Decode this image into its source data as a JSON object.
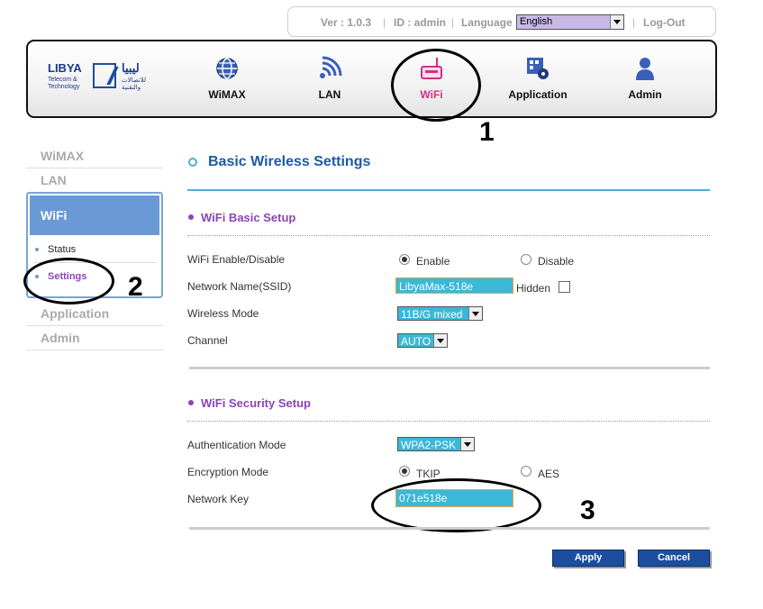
{
  "topbar": {
    "version": "Ver : 1.0.3",
    "id": "ID : admin",
    "language_label": "Language",
    "language_value": "English",
    "logout": "Log-Out"
  },
  "logo": {
    "en_name": "LIBYA",
    "en_sub": "Telecom & Technology",
    "ar_name": "ليبيا",
    "ar_sub": "للاتصالات والتقنية"
  },
  "nav": [
    {
      "label": "WiMAX",
      "icon": "globe-icon"
    },
    {
      "label": "LAN",
      "icon": "signal-icon"
    },
    {
      "label": "WiFi",
      "icon": "router-icon",
      "active": true
    },
    {
      "label": "Application",
      "icon": "application-gear-icon"
    },
    {
      "label": "Admin",
      "icon": "user-icon"
    }
  ],
  "sidebar": {
    "items": [
      "WiMAX",
      "LAN",
      "WiFi",
      "Application",
      "Admin"
    ],
    "wifi_sub": [
      "Status",
      "Settings"
    ]
  },
  "annotations": {
    "one": "1",
    "two": "2",
    "three": "3"
  },
  "main": {
    "title": "Basic Wireless Settings",
    "basic": {
      "title": "WiFi Basic Setup",
      "enable_label": "WiFi Enable/Disable",
      "enable_option": "Enable",
      "disable_option": "Disable",
      "ssid_label": "Network Name(SSID)",
      "ssid_value": "LibyaMax-518e",
      "hidden_label": "Hidden",
      "mode_label": "Wireless Mode",
      "mode_value": "11B/G mixed",
      "channel_label": "Channel",
      "channel_value": "AUTO"
    },
    "security": {
      "title": "WiFi Security Setup",
      "auth_label": "Authentication Mode",
      "auth_value": "WPA2-PSK",
      "enc_label": "Encryption Mode",
      "enc_tkip": "TKIP",
      "enc_aes": "AES",
      "key_label": "Network Key",
      "key_value": "071e518e"
    },
    "apply": "Apply",
    "cancel": "Cancel"
  },
  "colors": {
    "accent": "#1c5aa8",
    "section": "#8a45b8",
    "field": "#3ab8d8",
    "active_nav": "#d0308a"
  }
}
